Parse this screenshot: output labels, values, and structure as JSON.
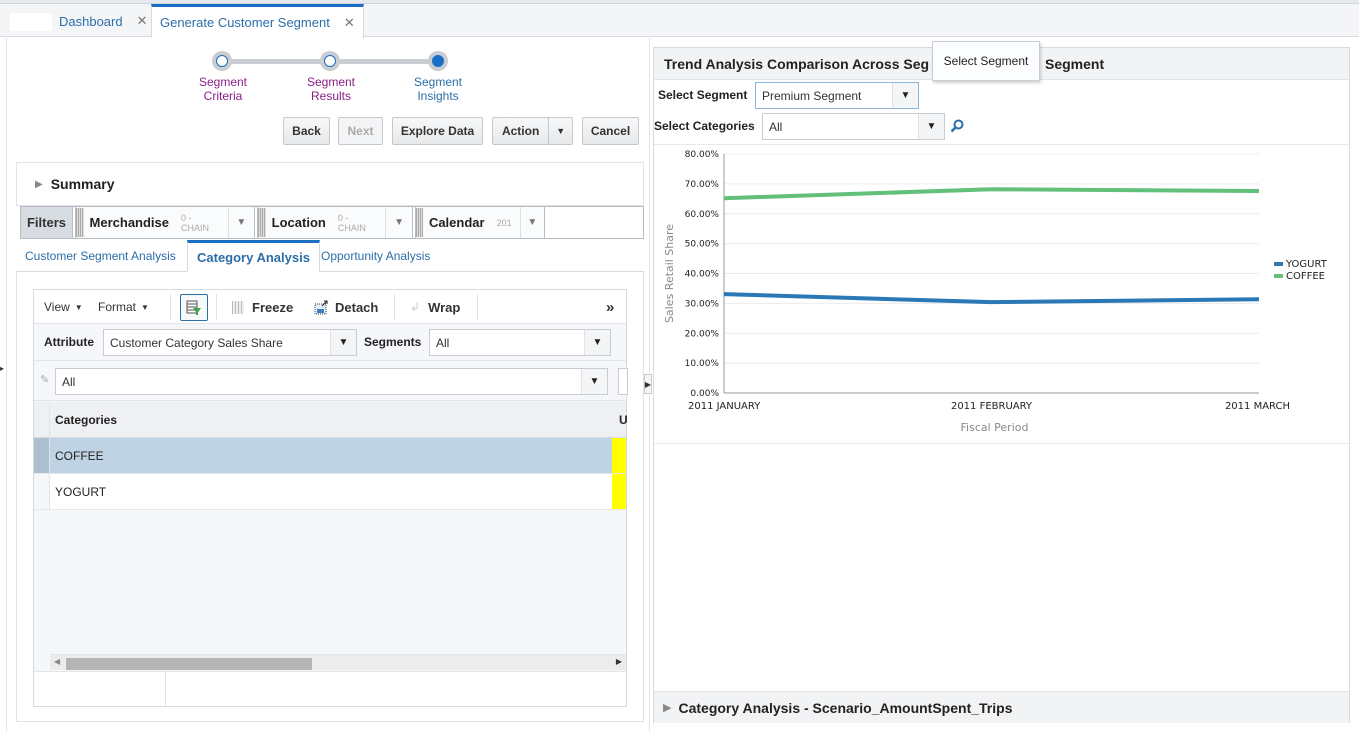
{
  "tabs": [
    {
      "label": "Dashboard",
      "active": false
    },
    {
      "label": "Generate Customer Segment",
      "active": true
    }
  ],
  "train": {
    "steps": [
      {
        "label_line1": "Segment",
        "label_line2": "Criteria",
        "state": "visited"
      },
      {
        "label_line1": "Segment",
        "label_line2": "Results",
        "state": "visited"
      },
      {
        "label_line1": "Segment",
        "label_line2": "Insights",
        "state": "current"
      }
    ]
  },
  "buttons": {
    "back": "Back",
    "next": "Next",
    "explore": "Explore Data",
    "action": "Action",
    "cancel": "Cancel"
  },
  "summary": {
    "title": "Summary"
  },
  "filters": {
    "label": "Filters",
    "items": [
      {
        "name": "Merchandise",
        "value": "0 - CHAIN"
      },
      {
        "name": "Location",
        "value": "0 - CHAIN"
      },
      {
        "name": "Calendar",
        "value": "201"
      }
    ]
  },
  "subtabs": [
    {
      "label": "Customer Segment Analysis",
      "active": false
    },
    {
      "label": "Category Analysis",
      "active": true
    },
    {
      "label": "Opportunity Analysis",
      "active": false
    }
  ],
  "grid": {
    "toolbar": {
      "view": "View",
      "format": "Format",
      "freeze": "Freeze",
      "detach": "Detach",
      "wrap": "Wrap",
      "overflow": "»"
    },
    "attribute_label": "Attribute",
    "attribute_value": "Customer Category Sales Share",
    "segments_label": "Segments",
    "segments_value": "All",
    "filter_value": "All",
    "columns": [
      "Categories",
      "U"
    ],
    "rows": [
      {
        "category": "COFFEE",
        "selected": true
      },
      {
        "category": "YOGURT",
        "selected": false
      }
    ],
    "highlight_color": "#ffff00"
  },
  "right_panel": {
    "title_visible_left": "Trend Analysis Comparison Across Seg",
    "title_visible_right": "Segment",
    "tooltip": "Select Segment",
    "select_segment_label": "Select Segment",
    "select_segment_value": "Premium Segment",
    "select_categories_label": "Select Categories",
    "select_categories_value": "All",
    "bottom_section": "Category Analysis - Scenario_AmountSpent_Trips"
  },
  "chart_data": {
    "type": "line",
    "title": "",
    "xlabel": "Fiscal Period",
    "ylabel": "Sales Retail Share",
    "x": [
      "2011 JANUARY",
      "2011 FEBRUARY",
      "2011 MARCH"
    ],
    "ylim": [
      0,
      80
    ],
    "yticks": [
      "0.00%",
      "10.00%",
      "20.00%",
      "30.00%",
      "40.00%",
      "50.00%",
      "60.00%",
      "70.00%",
      "80.00%"
    ],
    "grid": true,
    "legend": "right",
    "series": [
      {
        "name": "YOGURT",
        "color": "#2a78b5",
        "values": [
          33.1,
          30.4,
          31.4
        ]
      },
      {
        "name": "COFFEE",
        "color": "#62c07a",
        "values": [
          65.2,
          68.2,
          67.6
        ]
      }
    ]
  }
}
